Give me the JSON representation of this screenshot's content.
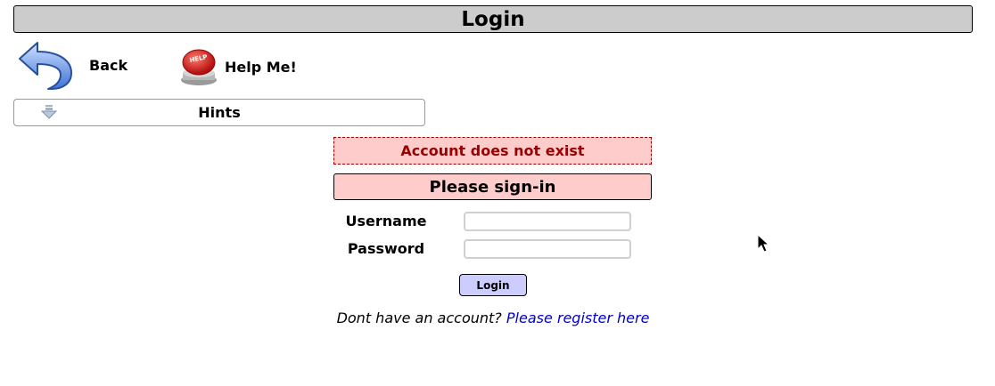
{
  "page": {
    "title": "Login"
  },
  "nav": {
    "back_label": "Back",
    "help_label": "Help Me!"
  },
  "hints": {
    "label": "Hints"
  },
  "error": {
    "message": "Account does not exist"
  },
  "form": {
    "header": "Please sign-in",
    "username_label": "Username",
    "username_value": "",
    "password_label": "Password",
    "password_value": "",
    "login_button": "Login"
  },
  "register": {
    "prompt": "Dont have an account?",
    "link_text": "Please register here"
  },
  "colors": {
    "title_bg": "#cccccc",
    "error_bg": "#ffcccc",
    "error_text": "#990000",
    "button_bg": "#ccccff",
    "link": "#0000cc"
  },
  "icons": {
    "back": "back-arrow-icon",
    "help": "help-button-icon",
    "hints": "arrow-down-icon",
    "cursor": "mouse-pointer-icon"
  }
}
